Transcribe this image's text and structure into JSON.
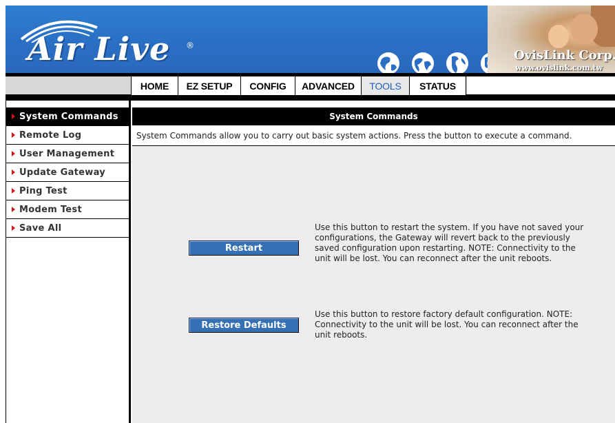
{
  "banner": {
    "brand": "Air Live",
    "reg_mark": "®",
    "corp_name": "OvisLink Corp.",
    "corp_url": "www.ovislink.com.tw",
    "globe_icons": [
      "globe-icon",
      "globe-icon",
      "globe-icon",
      "globe-icon"
    ]
  },
  "nav": {
    "tabs": [
      {
        "label": "HOME",
        "active": false
      },
      {
        "label": "EZ SETUP",
        "active": false
      },
      {
        "label": "CONFIG",
        "active": false
      },
      {
        "label": "ADVANCED",
        "active": false
      },
      {
        "label": "TOOLS",
        "active": true
      },
      {
        "label": "STATUS",
        "active": false
      }
    ]
  },
  "sidebar": {
    "items": [
      {
        "label": "System Commands",
        "active": true
      },
      {
        "label": "Remote Log",
        "active": false
      },
      {
        "label": "User Management",
        "active": false
      },
      {
        "label": "Update Gateway",
        "active": false
      },
      {
        "label": "Ping Test",
        "active": false
      },
      {
        "label": "Modem Test",
        "active": false
      },
      {
        "label": "Save All",
        "active": false
      }
    ]
  },
  "main": {
    "title": "System Commands",
    "description": "System Commands allow you to carry out basic system actions. Press the button to execute a command.",
    "restart_label": "Restart",
    "restart_note": "Use this button to restart the system. If you have not saved your configurations, the Gateway will revert back to the previously saved configuration upon restarting. NOTE: Connectivity to the unit will be lost. You can reconnect after the unit reboots.",
    "restore_label": "Restore Defaults",
    "restore_note": "Use this button to restore factory default configuration. NOTE: Connectivity to the unit will be lost. You can reconnect after the unit reboots."
  },
  "colors": {
    "banner_blue": "#2a6fc4",
    "button_blue": "#3570b4",
    "active_tab_text": "#1b5fbd",
    "sidebar_arrow": "#dd1111"
  }
}
